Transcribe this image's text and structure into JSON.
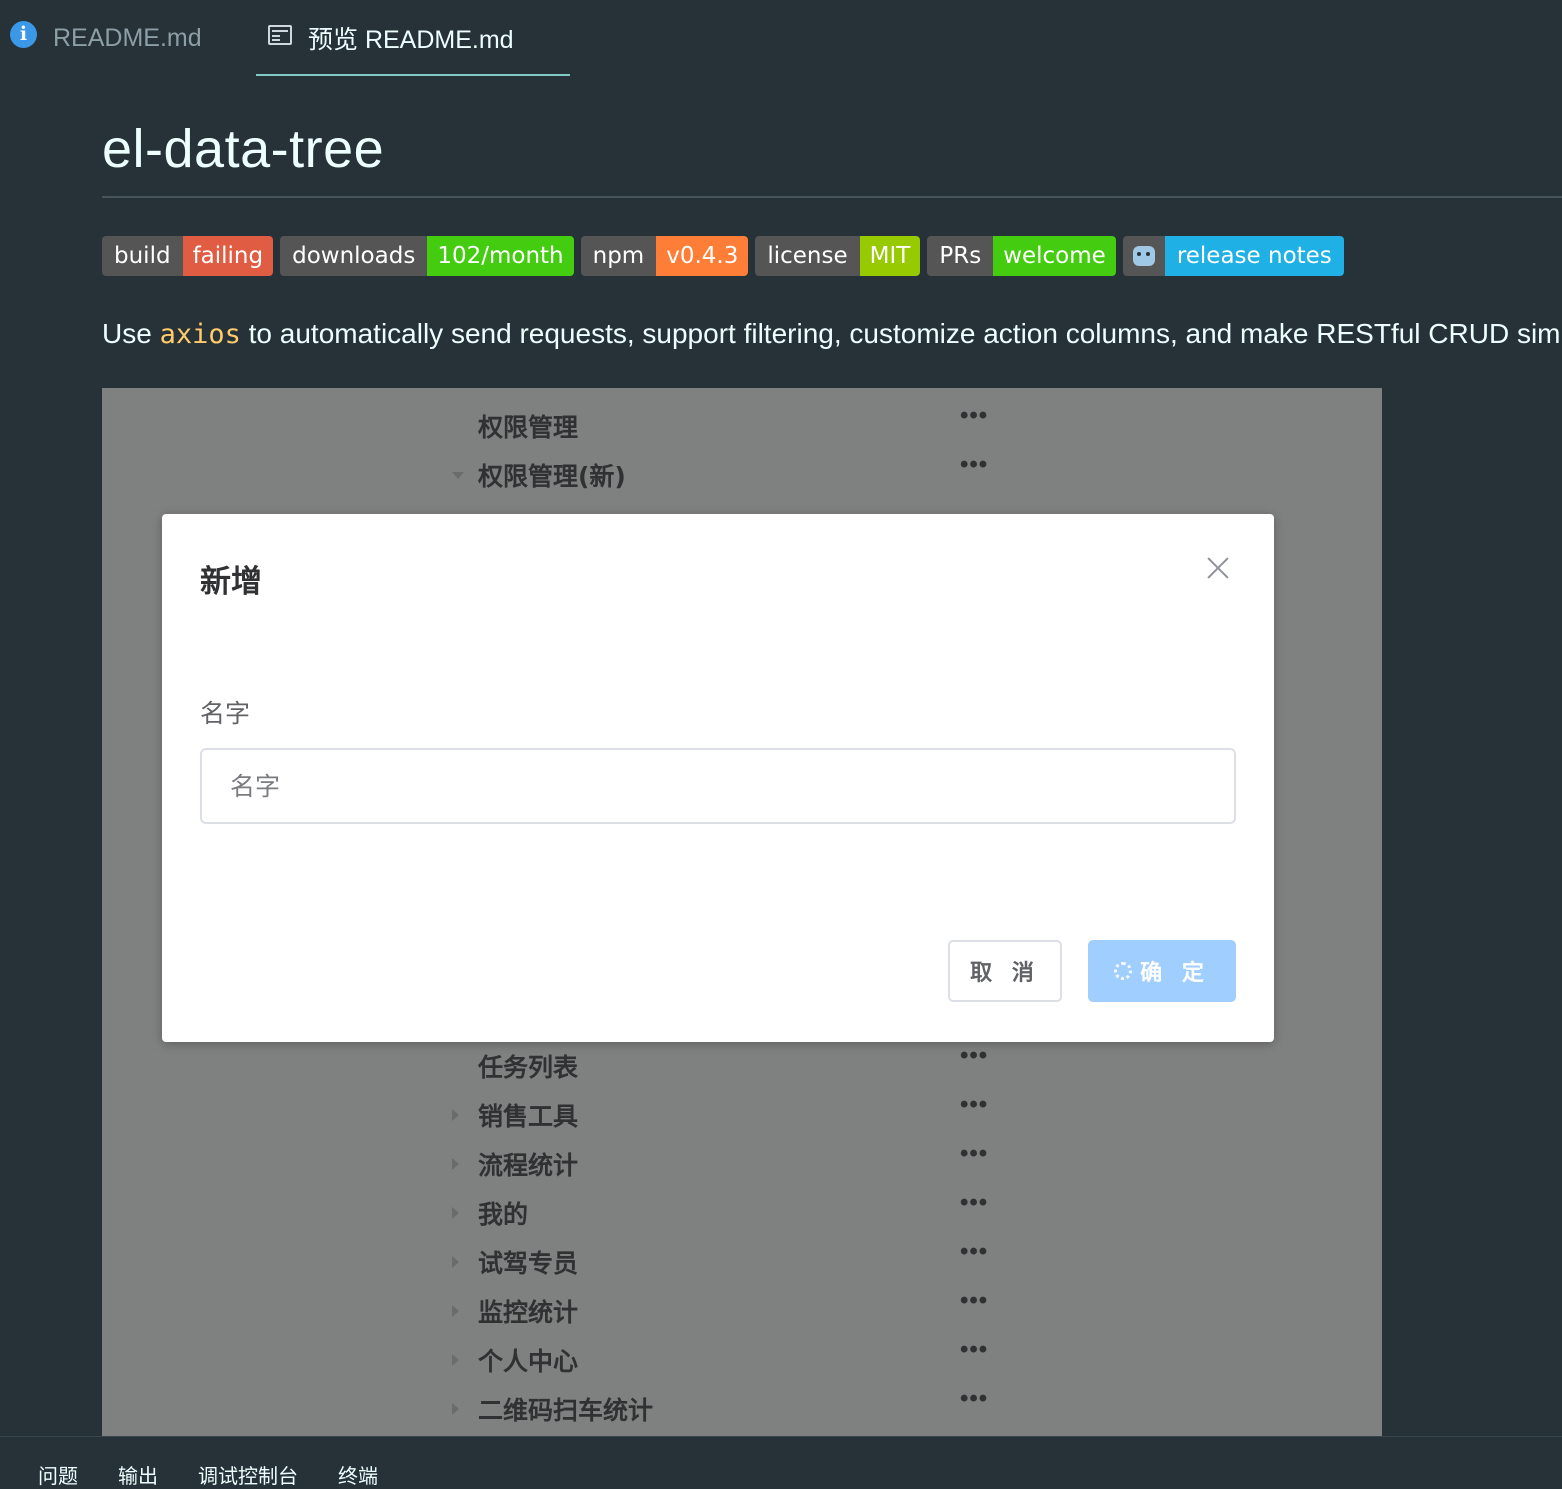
{
  "tabs": [
    {
      "label": "README.md",
      "icon": "info-icon"
    },
    {
      "label": "预览 README.md",
      "icon": "preview-icon"
    }
  ],
  "title": "el-data-tree",
  "badges": [
    {
      "left": "build",
      "right": "failing",
      "color": "#e05d44"
    },
    {
      "left": "downloads",
      "right": "102/month",
      "color": "#4c1"
    },
    {
      "left": "npm",
      "right": "v0.4.3",
      "color": "#fe7d37"
    },
    {
      "left": "license",
      "right": "MIT",
      "color": "#97ca00"
    },
    {
      "left": "PRs",
      "right": "welcome",
      "color": "#4c1"
    },
    {
      "left": "",
      "right": "release notes",
      "color": "#1fb0e6",
      "icon": "robot-icon"
    }
  ],
  "description": {
    "before": "Use ",
    "code": "axios",
    "after": " to automatically send requests, support filtering, customize action columns, and make RESTful CRUD simpler"
  },
  "tree": {
    "top_rows": [
      {
        "label": "权限管理",
        "caret": "none"
      },
      {
        "label": "权限管理(新)",
        "caret": "down"
      }
    ],
    "bottom_rows": [
      {
        "label": "任务列表",
        "caret": "none"
      },
      {
        "label": "销售工具",
        "caret": "right"
      },
      {
        "label": "流程统计",
        "caret": "right"
      },
      {
        "label": "我的",
        "caret": "right"
      },
      {
        "label": "试驾专员",
        "caret": "right"
      },
      {
        "label": "监控统计",
        "caret": "right"
      },
      {
        "label": "个人中心",
        "caret": "right"
      },
      {
        "label": "二维码扫车统计",
        "caret": "right"
      }
    ],
    "more_label": "•••"
  },
  "dialog": {
    "title": "新增",
    "field_label": "名字",
    "input_placeholder": "名字",
    "input_value": "",
    "cancel_label": "取 消",
    "confirm_label": "确 定"
  },
  "panel_tabs": [
    "问题",
    "输出",
    "调试控制台",
    "终端"
  ]
}
